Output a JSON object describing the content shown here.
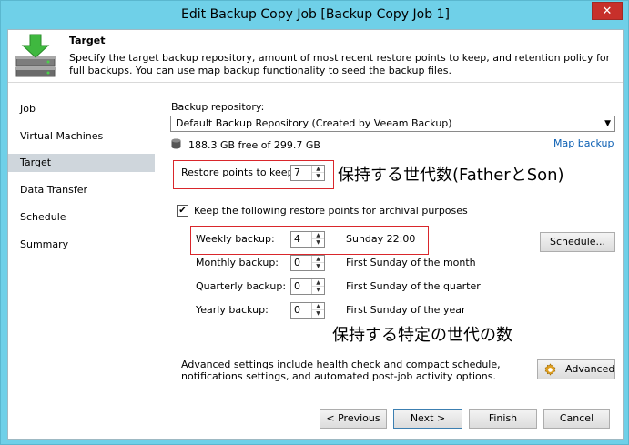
{
  "window": {
    "title": "Edit Backup Copy Job [Backup Copy Job 1]",
    "close_label": "✕"
  },
  "header": {
    "title": "Target",
    "description": "Specify the target backup repository, amount of most recent restore points to keep, and retention policy for full backups. You can use map backup functionality to seed the backup files."
  },
  "sidebar": {
    "items": [
      {
        "label": "Job"
      },
      {
        "label": "Virtual Machines"
      },
      {
        "label": "Target"
      },
      {
        "label": "Data Transfer"
      },
      {
        "label": "Schedule"
      },
      {
        "label": "Summary"
      }
    ],
    "active_index": 2
  },
  "target": {
    "repository_label": "Backup repository:",
    "repository_value": "Default Backup Repository (Created by Veeam Backup)",
    "free_space": "188.3 GB free of 299.7 GB",
    "map_backup_link": "Map backup",
    "restore_points_label": "Restore points to keep:",
    "restore_points_value": "7",
    "archival_checkbox_label": "Keep the following restore points for archival purposes",
    "archival_checked": true,
    "rows": [
      {
        "label": "Weekly backup:",
        "value": "4",
        "schedule": "Sunday 22:00"
      },
      {
        "label": "Monthly backup:",
        "value": "0",
        "schedule": "First Sunday of the month"
      },
      {
        "label": "Quarterly backup:",
        "value": "0",
        "schedule": "First Sunday of the quarter"
      },
      {
        "label": "Yearly backup:",
        "value": "0",
        "schedule": "First Sunday of the year"
      }
    ],
    "schedule_button": "Schedule...",
    "advanced_text": "Advanced settings include health check and compact schedule, notifications settings, and automated post-job activity options.",
    "advanced_button": "Advanced"
  },
  "annotations": {
    "restore_points_note": "保持する世代数(FatherとSon)",
    "archival_note": "保持する特定の世代の数"
  },
  "footer": {
    "previous": "< Previous",
    "next": "Next >",
    "finish": "Finish",
    "cancel": "Cancel"
  },
  "colors": {
    "window_frame": "#6fd0e8",
    "close_button": "#c7302b",
    "highlight_box": "#d9262b",
    "link": "#0b5fb3",
    "active_nav": "#cfd6dc"
  },
  "icons": [
    "target-header-icon",
    "database-icon",
    "gear-icon",
    "spin-up-icon",
    "spin-down-icon",
    "dropdown-arrow-icon",
    "checkmark-icon"
  ]
}
